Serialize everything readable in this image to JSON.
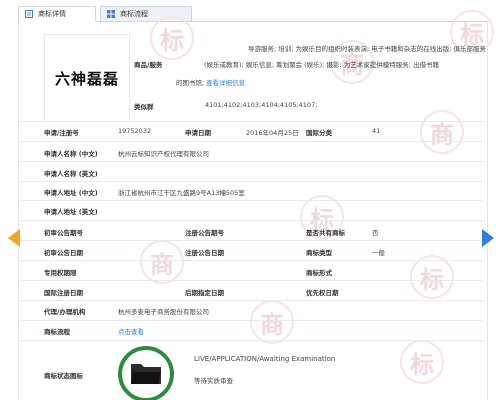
{
  "tabs": [
    {
      "label": "商标详情",
      "active": true
    },
    {
      "label": "商标流程",
      "active": false
    }
  ],
  "trademark": {
    "logo_text": "六神磊磊",
    "services_label": "商品/服务",
    "services_lines": [
      "导游服务; 培训; 为娱乐目的组织时装表演; 电子书籍和杂志的在线出版; 俱乐部服务",
      "(娱乐或教育); 娱乐信息; 筹划聚会 (娱乐); 摄影; 为艺术家提供模特服务; 出借书籍",
      "的图书馆;"
    ],
    "services_link": "查看详细信息",
    "groups_label": "类似群",
    "groups_value": "4101;4102;4103;4104;4105;4107;"
  },
  "fields": {
    "app_no_label": "申请/注册号",
    "app_no_value": "19752032",
    "app_date_label": "申请日期",
    "app_date_value": "2016年04月25日",
    "intl_class_label": "国际分类",
    "intl_class_value": "41",
    "applicant_cn_label": "申请人名称 (中文)",
    "applicant_cn_value": "杭州云标知识产权代理有限公司",
    "applicant_en_label": "申请人名称 (英文)",
    "address_cn_label": "申请人地址 (中文)",
    "address_cn_value": "浙江省杭州市江干区九盛路9号A13幢505室",
    "address_en_label": "申请人地址 (英文)",
    "prelim_no_label": "初审公告期号",
    "reg_no_label": "注册公告期号",
    "shared_label": "是否共有商标",
    "shared_value": "否",
    "prelim_date_label": "初审公告日期",
    "reg_date_label": "注册公告日期",
    "tm_type_label": "商标类型",
    "tm_type_value": "一般",
    "exclusive_label": "专用权期限",
    "tm_form_label": "商标形式",
    "intl_reg_date_label": "国际注册日期",
    "later_date_label": "后期指定日期",
    "priority_label": "优先权日期",
    "agent_label": "代理/办理机构",
    "agent_value": "杭州多麦电子商务股份有限公司",
    "process_label": "商标流程",
    "process_link": "点击查看",
    "status_label": "商标状态图标",
    "status_en": "LIVE/APPLICATION/Awaiting Examination",
    "status_cn": "等待实质审查"
  },
  "watermark": [
    "标",
    "商",
    "标",
    "商",
    "标",
    "商",
    "标",
    "商",
    "标"
  ],
  "colors": {
    "link": "#2f7fd6",
    "arrow_left": "#f5a623",
    "arrow_right": "#2f7fd6",
    "status_ring": "#2e8b3e"
  }
}
